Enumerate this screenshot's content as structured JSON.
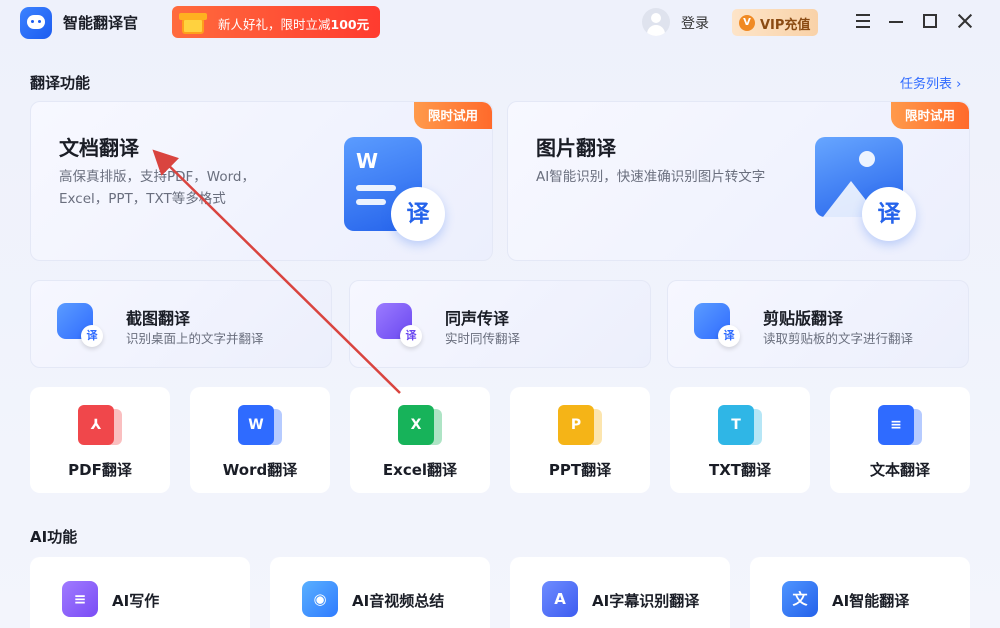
{
  "app": {
    "title": "智能翻译官",
    "logo_icon": "chat-bubble-icon"
  },
  "promo": {
    "prefix": "新人好礼，限时立减",
    "amount": "100元"
  },
  "header": {
    "login": "登录",
    "vip": "VIP充值",
    "vip_badge": "V"
  },
  "section1": {
    "title": "翻译功能",
    "task_list": "任务列表 ›"
  },
  "big_cards": [
    {
      "title": "文档翻译",
      "desc": "高保真排版，支持PDF，Word，Excel，PPT，TXT等多格式",
      "badge": "限时试用",
      "icon_letter": "W",
      "icon_tag": "译"
    },
    {
      "title": "图片翻译",
      "desc": "AI智能识别，快速准确识别图片转文字",
      "badge": "限时试用",
      "icon_tag": "译"
    }
  ],
  "mid_cards": [
    {
      "title": "截图翻译",
      "desc": "识别桌面上的文字并翻译",
      "tag": "译",
      "color": "#3b82ff"
    },
    {
      "title": "同声传译",
      "desc": "实时同传翻译",
      "tag": "译",
      "color": "#7c5cff"
    },
    {
      "title": "剪贴版翻译",
      "desc": "读取剪贴板的文字进行翻译",
      "tag": "译",
      "color": "#3b82ff"
    }
  ],
  "file_cards": [
    {
      "label": "PDF翻译",
      "glyph": "⅄",
      "color": "#f0474b"
    },
    {
      "label": "Word翻译",
      "glyph": "W",
      "color": "#2f6bff"
    },
    {
      "label": "Excel翻译",
      "glyph": "X",
      "color": "#17b35a"
    },
    {
      "label": "PPT翻译",
      "glyph": "P",
      "color": "#f5b417"
    },
    {
      "label": "TXT翻译",
      "glyph": "T",
      "color": "#2fb6e6"
    },
    {
      "label": "文本翻译",
      "glyph": "≡",
      "color": "#2f6bff"
    }
  ],
  "section2": {
    "title": "AI功能"
  },
  "ai_cards": [
    {
      "label": "AI写作",
      "glyph": "≡",
      "color": "#8a5cff"
    },
    {
      "label": "AI音视频总结",
      "glyph": "◉",
      "color": "#2f8bff"
    },
    {
      "label": "AI字幕识别翻译",
      "glyph": "A",
      "color": "#4a6cff"
    },
    {
      "label": "AI智能翻译",
      "glyph": "文",
      "color": "#2f6bff"
    }
  ]
}
